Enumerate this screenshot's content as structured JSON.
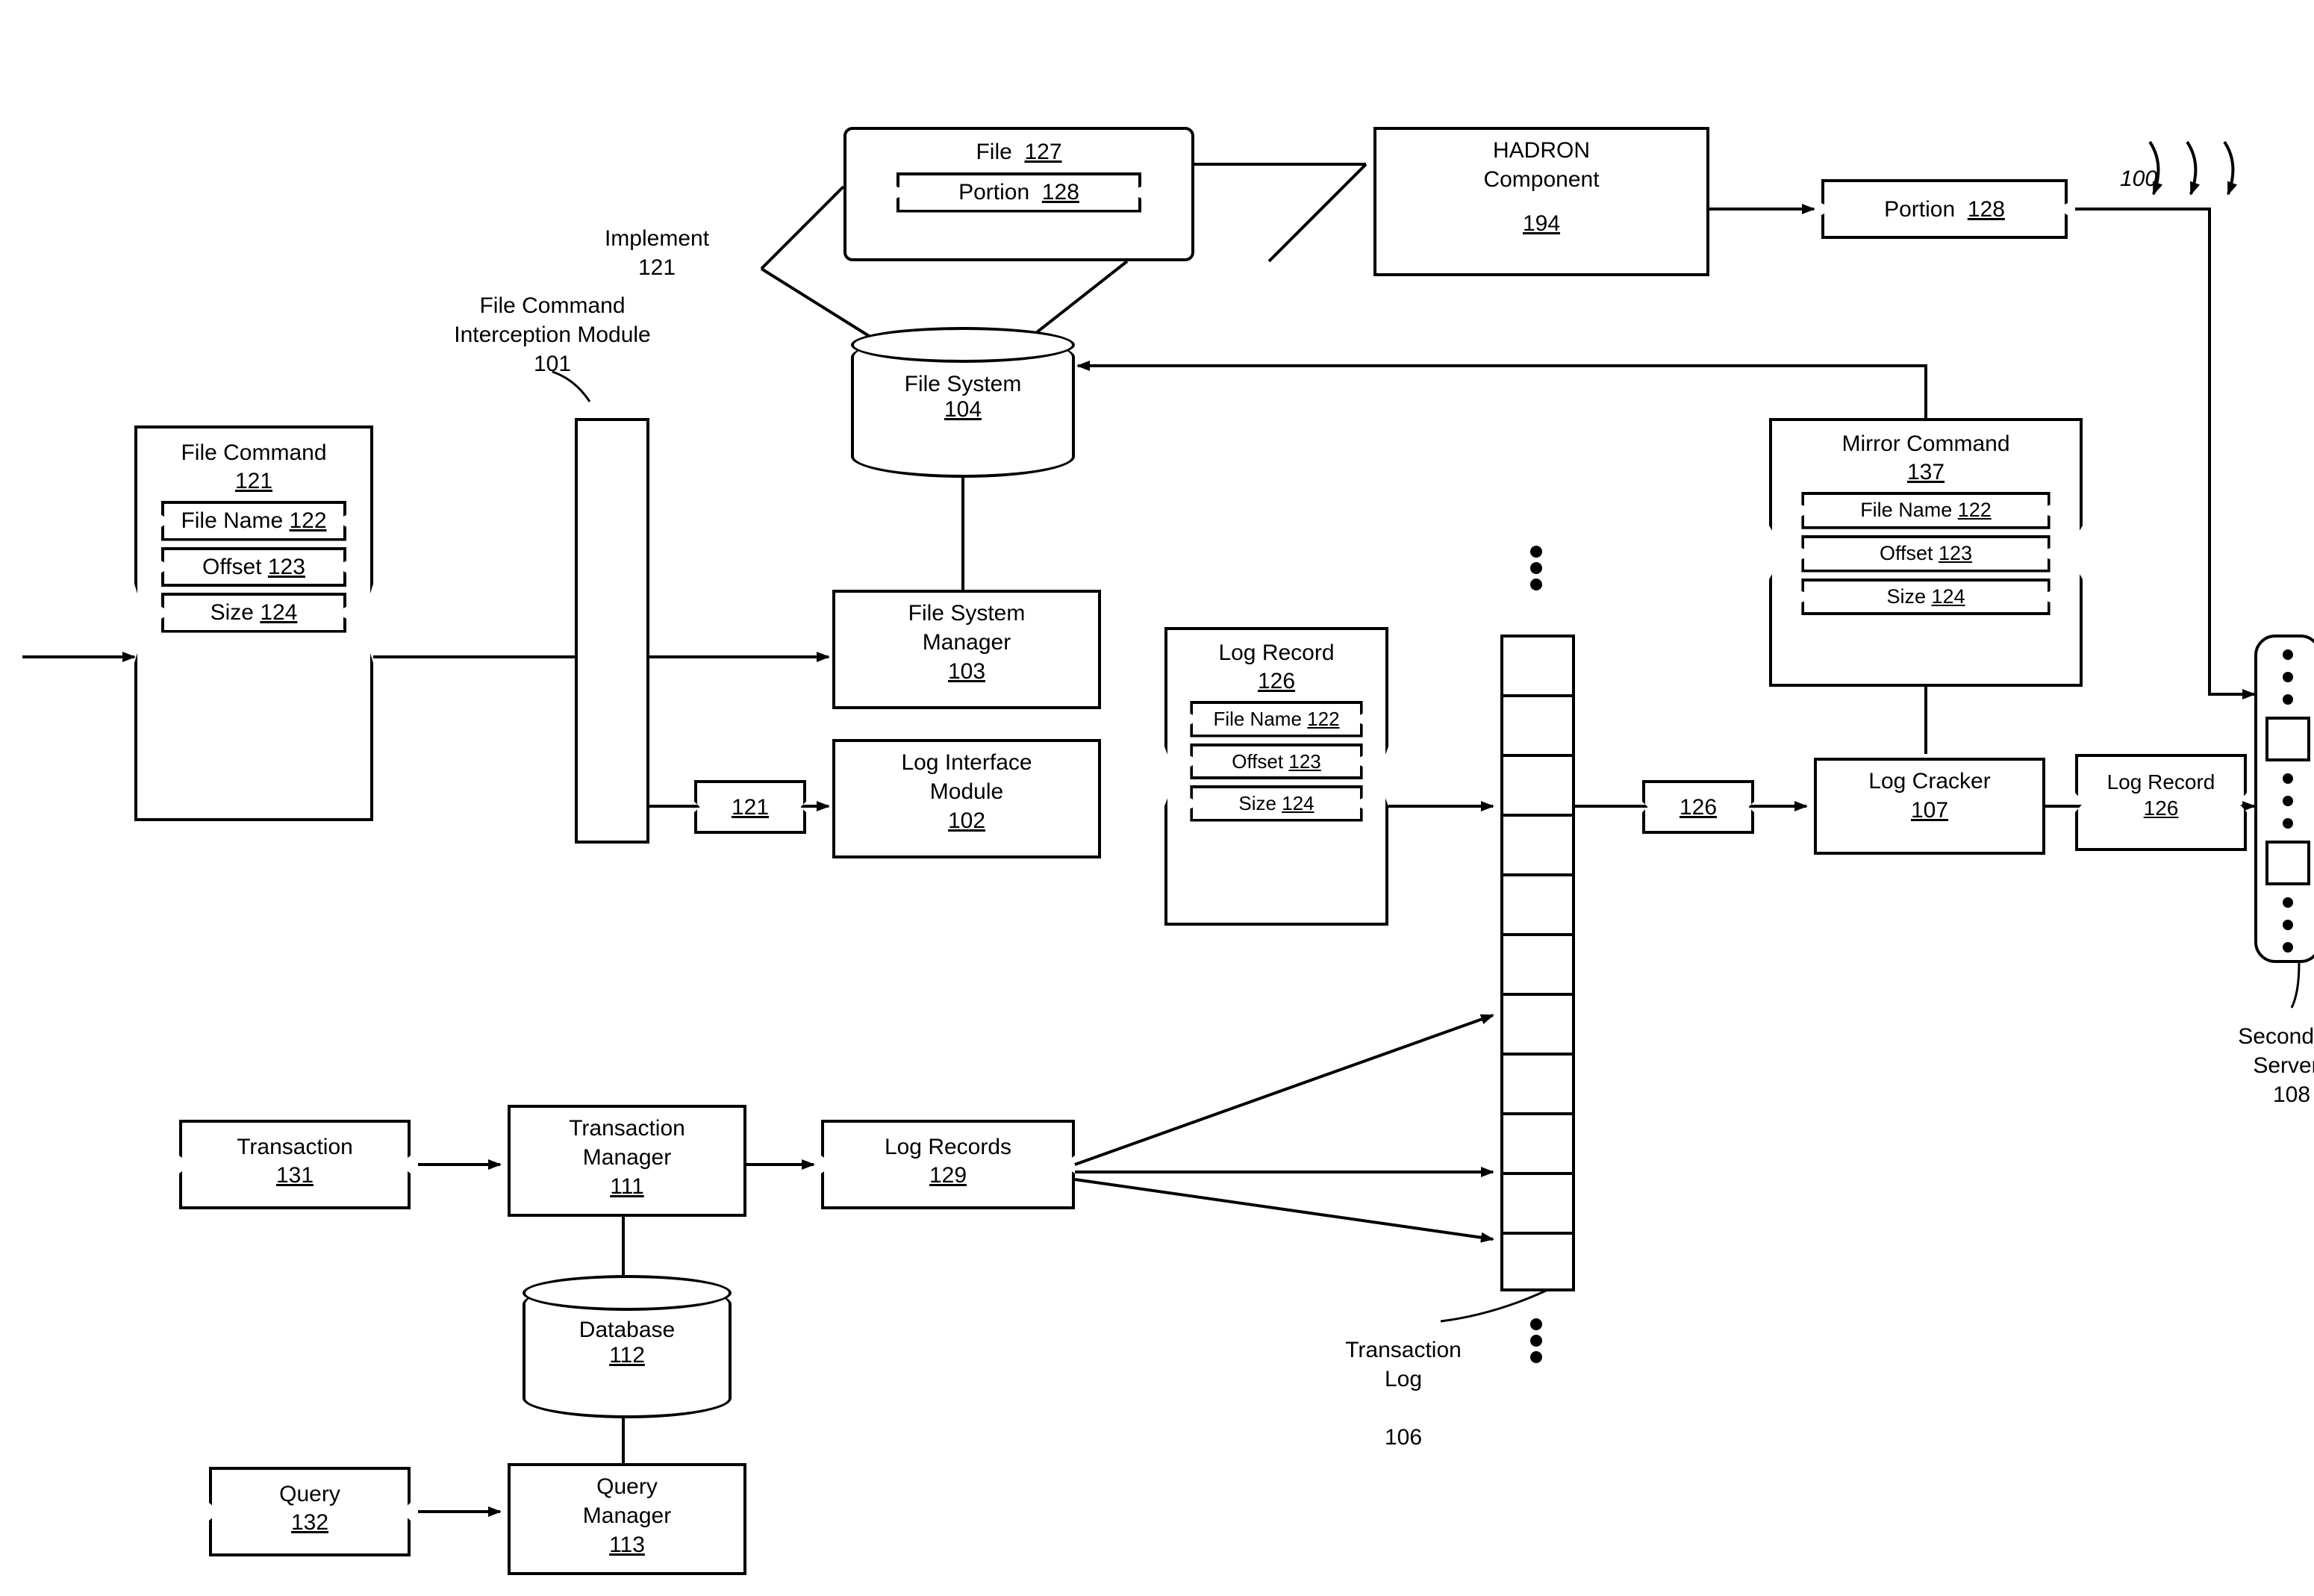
{
  "fig": {
    "num": "100"
  },
  "fileCmdInterceptLabel": "File Command\nInterception Module\n101",
  "implementLabel": "Implement\n121",
  "fileCommand": {
    "title": "File Command",
    "num": "121",
    "fields": [
      {
        "label": "File Name",
        "num": "122"
      },
      {
        "label": "Offset",
        "num": "123"
      },
      {
        "label": "Size",
        "num": "124"
      }
    ]
  },
  "fileBox": {
    "title": "File",
    "num": "127",
    "portion": "Portion",
    "portionNum": "128"
  },
  "hadron": {
    "title": "HADRON\nComponent",
    "num": "194"
  },
  "portionOut": {
    "label": "Portion",
    "num": "128"
  },
  "fileSystem": {
    "title": "File System",
    "num": "104"
  },
  "fsManager": {
    "title": "File System\nManager",
    "num": "103"
  },
  "logInterface": {
    "title": "Log Interface\nModule",
    "num": "102"
  },
  "logRecord": {
    "title": "Log Record",
    "num": "126",
    "fields": [
      {
        "label": "File Name",
        "num": "122"
      },
      {
        "label": "Offset",
        "num": "123"
      },
      {
        "label": "Size",
        "num": "124"
      }
    ]
  },
  "smallLogRecord": {
    "label": "Log Record",
    "num": "126"
  },
  "logCracker": {
    "title": "Log Cracker",
    "num": "107"
  },
  "mirrorCmd": {
    "title": "Mirror Command",
    "num": "137",
    "fields": [
      {
        "label": "File Name",
        "num": "122"
      },
      {
        "label": "Offset",
        "num": "123"
      },
      {
        "label": "Size",
        "num": "124"
      }
    ]
  },
  "midArrow121": "121",
  "midArrow126": "126",
  "transaction": {
    "label": "Transaction",
    "num": "131"
  },
  "transMgr": {
    "title": "Transaction\nManager",
    "num": "111"
  },
  "database": {
    "title": "Database",
    "num": "112"
  },
  "logRecords": {
    "label": "Log Records",
    "num": "129"
  },
  "query": {
    "label": "Query",
    "num": "132"
  },
  "queryMgr": {
    "title": "Query\nManager",
    "num": "113"
  },
  "transLog": {
    "label": "Transaction\nLog",
    "num": "106"
  },
  "servers": {
    "label": "Secondary\nServers",
    "num": "108"
  }
}
